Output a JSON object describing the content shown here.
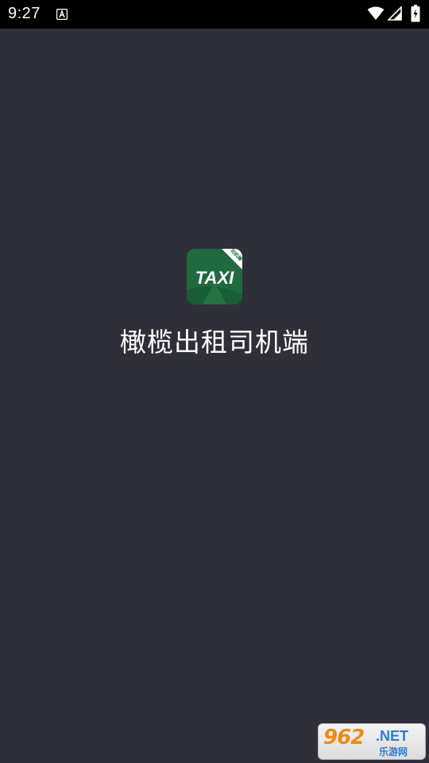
{
  "status_bar": {
    "time": "9:27",
    "notification_icon": "accessibility-a-icon",
    "wifi_icon": "wifi-icon",
    "signal_icon": "cell-signal-icon",
    "battery_icon": "battery-charging-icon"
  },
  "splash": {
    "logo_text": "TAXI",
    "logo_badge": "司机端",
    "logo_color": "#1f6b3f",
    "app_title": "橄榄出租司机端"
  },
  "watermark": {
    "number": "962",
    "domain": ".NET",
    "subtitle": "乐游网"
  },
  "colors": {
    "background": "#2f2f39",
    "status_bar": "#000000",
    "title_text": "#ffffff"
  }
}
